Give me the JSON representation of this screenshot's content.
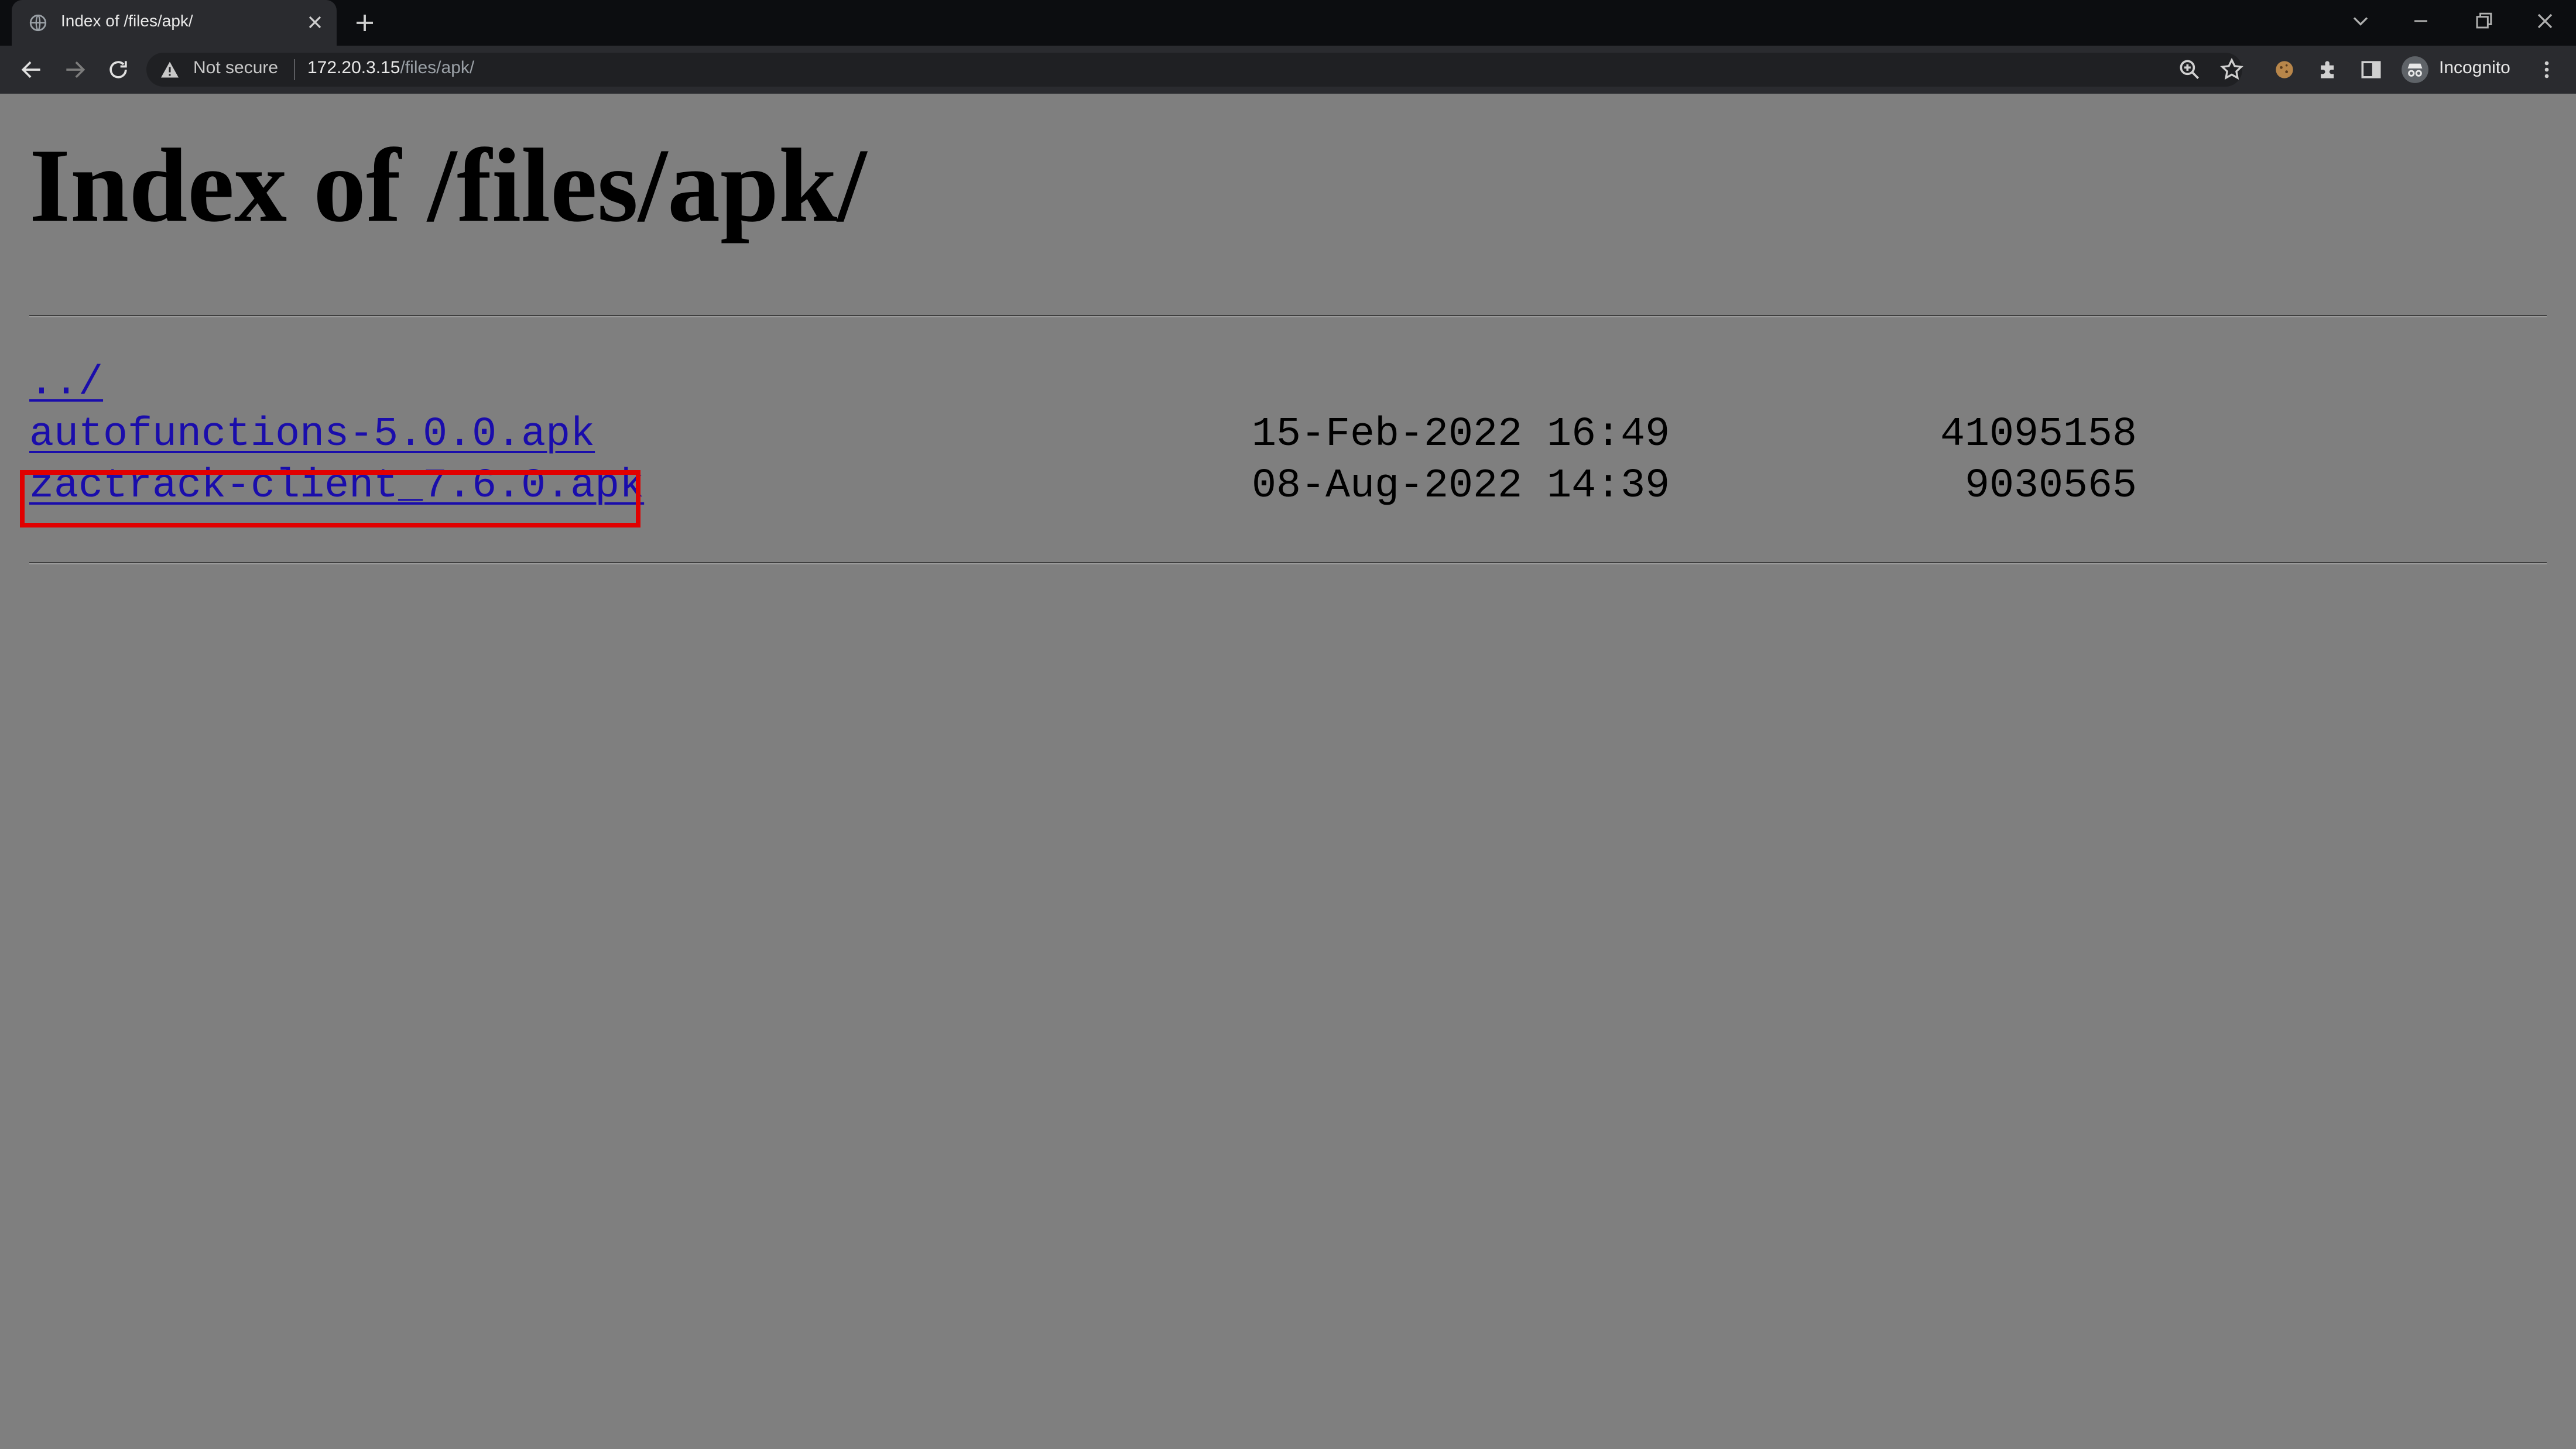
{
  "browser": {
    "tab": {
      "title": "Index of /files/apk/"
    },
    "address_bar": {
      "security_label": "Not secure",
      "url_host": "172.20.3.15",
      "url_path": "/files/apk/"
    },
    "profile_label": "Incognito",
    "icons": {
      "tab_favicon": "globe-icon",
      "tab_close": "close-icon",
      "new_tab": "plus-icon",
      "back": "back-arrow-icon",
      "forward": "forward-arrow-icon",
      "reload": "reload-icon",
      "security": "warning-triangle-icon",
      "zoom": "zoom-icon",
      "bookmark": "star-icon",
      "extension_cookie": "cookie-icon",
      "extensions": "puzzle-icon",
      "side_panel": "side-panel-icon",
      "incognito": "incognito-icon",
      "menu": "kebab-menu-icon"
    }
  },
  "page": {
    "title": "Index of /files/apk/",
    "entries": [
      {
        "name": "../",
        "date": "",
        "size": ""
      },
      {
        "name": "autofunctions-5.0.0.apk",
        "date": "15-Feb-2022 16:49",
        "size": "41095158"
      },
      {
        "name": "zactrack-client_7.6.0.apk",
        "date": "08-Aug-2022 14:39",
        "size": "9030565"
      }
    ],
    "colors": {
      "background": "#7f7f7f",
      "link": "#1a0dab",
      "highlight_box": "#e10000"
    }
  }
}
